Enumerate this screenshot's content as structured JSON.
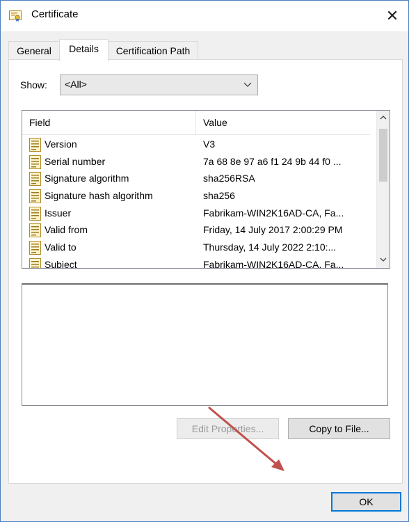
{
  "window": {
    "title": "Certificate"
  },
  "tabs": [
    {
      "label": "General"
    },
    {
      "label": "Details"
    },
    {
      "label": "Certification Path"
    }
  ],
  "details": {
    "show_label": "Show:",
    "show_value": "<All>",
    "columns": {
      "field": "Field",
      "value": "Value"
    },
    "rows": [
      {
        "field": "Version",
        "value": "V3"
      },
      {
        "field": "Serial number",
        "value": "7a 68 8e 97 a6 f1 24 9b 44 f0 ..."
      },
      {
        "field": "Signature algorithm",
        "value": "sha256RSA"
      },
      {
        "field": "Signature hash algorithm",
        "value": "sha256"
      },
      {
        "field": "Issuer",
        "value": "Fabrikam-WIN2K16AD-CA, Fa..."
      },
      {
        "field": "Valid from",
        "value": "Friday, 14 July 2017 2:00:29 PM"
      },
      {
        "field": "Valid to",
        "value": "Thursday, 14 July 2022 2:10:..."
      },
      {
        "field": "Subject",
        "value": "Fabrikam-WIN2K16AD-CA, Fa..."
      }
    ],
    "edit_properties_label": "Edit Properties...",
    "copy_to_file_label": "Copy to File..."
  },
  "footer": {
    "ok_label": "OK"
  },
  "colors": {
    "accent": "#0078d7",
    "annotation_arrow": "#c0504d"
  }
}
